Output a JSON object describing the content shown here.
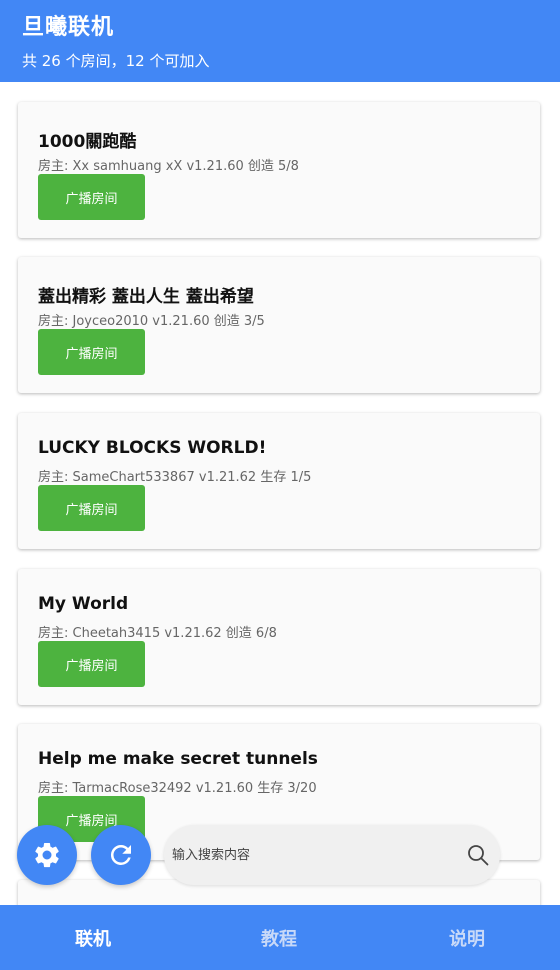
{
  "header": {
    "title": "旦曦联机",
    "subtitle": "共 26 个房间，12 个可加入"
  },
  "rooms": [
    {
      "name": "1000關跑酷",
      "info": "房主: Xx samhuang xX v1.21.60 创造 5/8",
      "button": "广播房间"
    },
    {
      "name": "蓋出精彩 蓋出人生 蓋出希望",
      "info": "房主: Joyceo2010 v1.21.60 创造 3/5",
      "button": "广播房间"
    },
    {
      "name": "LUCKY BLOCKS WORLD!",
      "info": "房主: SameChart533867 v1.21.62 生存 1/5",
      "button": "广播房间"
    },
    {
      "name": "My World",
      "info": "房主: Cheetah3415 v1.21.62 创造 6/8",
      "button": "广播房间"
    },
    {
      "name": "Help me make secret tunnels",
      "info": "房主: TarmacRose32492 v1.21.60 生存 3/20",
      "button": "广播房间"
    }
  ],
  "search": {
    "placeholder": "输入搜索内容",
    "value": ""
  },
  "icons": {
    "settings": "gear-icon",
    "refresh": "refresh-icon",
    "search": "search-icon"
  },
  "tabs": [
    {
      "label": "联机",
      "active": true
    },
    {
      "label": "教程",
      "active": false
    },
    {
      "label": "说明",
      "active": false
    }
  ],
  "colors": {
    "primary": "#4287f5",
    "button": "#4db33f",
    "tab_active": "#ffffff",
    "tab_inactive": "#c8d9f8"
  }
}
